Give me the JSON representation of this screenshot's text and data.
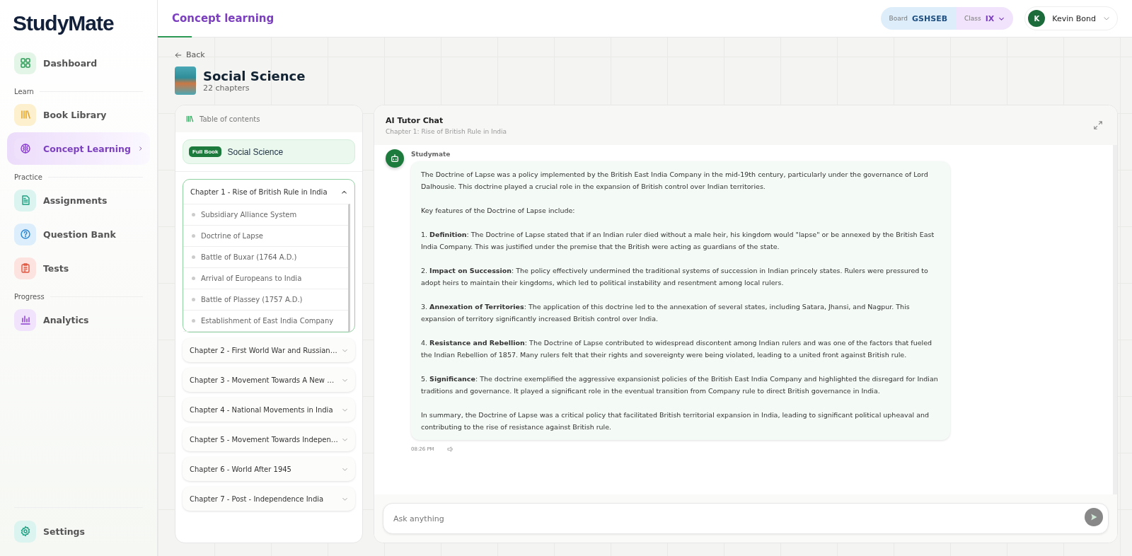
{
  "sidebar": {
    "logo": "StudyMate",
    "groups": [
      {
        "items": [
          {
            "label": "Dashboard",
            "selected": false
          }
        ]
      },
      {
        "heading": "Learn",
        "items": [
          {
            "label": "Book Library",
            "selected": false
          },
          {
            "label": "Concept Learning",
            "selected": true
          }
        ]
      },
      {
        "heading": "Practice",
        "items": [
          {
            "label": "Assignments",
            "selected": false
          },
          {
            "label": "Question Bank",
            "selected": false
          },
          {
            "label": "Tests",
            "selected": false
          }
        ]
      },
      {
        "heading": "Progress",
        "items": [
          {
            "label": "Analytics",
            "selected": false
          }
        ]
      }
    ],
    "footer": {
      "label": "Settings",
      "selected": false
    }
  },
  "header": {
    "title": "Concept learning",
    "board_label": "Board",
    "board": "GSHSEB",
    "class_label": "Class",
    "class": "IX",
    "user": {
      "initial": "K",
      "name": "Kevin Bond"
    }
  },
  "back": "Back",
  "book": {
    "title": "Social Science",
    "chapters": "22 chapters"
  },
  "toc": {
    "title": "Table of contents",
    "full_book": {
      "badge": "Full Book",
      "title": "Social Science"
    },
    "chapters": [
      {
        "title": "Chapter 1 - Rise of British Rule in India",
        "expanded": true,
        "topics": [
          "Subsidiary Alliance System",
          "Doctrine of Lapse",
          "Battle of Buxar (1764 A.D.)",
          "Arrival of Europeans to India",
          "Battle of Plassey (1757 A.D.)",
          "Establishment of East India Company"
        ]
      },
      {
        "title": "Chapter 2 - First World War and Russian…",
        "expanded": false
      },
      {
        "title": "Chapter 3 - Movement Towards A New …",
        "expanded": false
      },
      {
        "title": "Chapter 4 - National Movements in India",
        "expanded": false
      },
      {
        "title": "Chapter 5 - Movement Towards Indepen…",
        "expanded": false
      },
      {
        "title": "Chapter 6 - World After 1945",
        "expanded": false
      },
      {
        "title": "Chapter 7 - Post - Independence India",
        "expanded": false
      }
    ]
  },
  "chat": {
    "title": "AI Tutor Chat",
    "subtitle": "Chapter 1: Rise of British Rule in India",
    "messages": [
      {
        "sender": "Studymate",
        "time": "08:26 PM",
        "paragraphs": [
          "The Doctrine of Lapse was a policy implemented by the British East India Company in the mid-19th century, particularly under the governance of Lord Dalhousie. This doctrine played a crucial role in the expansion of British control over Indian territories.",
          "Key features of the Doctrine of Lapse include:",
          "1. **Definition**: The Doctrine of Lapse stated that if an Indian ruler died without a male heir, his kingdom would \"lapse\" or be annexed by the British East India Company. This was justified under the premise that the British were acting as guardians of the state.",
          "2. **Impact on Succession**: The policy effectively undermined the traditional systems of succession in Indian princely states. Rulers were pressured to adopt heirs to maintain their kingdoms, which led to political instability and resentment among local rulers.",
          "3. **Annexation of Territories**: The application of this doctrine led to the annexation of several states, including Satara, Jhansi, and Nagpur. This expansion of territory significantly increased British control over India.",
          "4. **Resistance and Rebellion**: The Doctrine of Lapse contributed to widespread discontent among Indian rulers and was one of the factors that fueled the Indian Rebellion of 1857. Many rulers felt that their rights and sovereignty were being violated, leading to a united front against British rule.",
          "5. **Significance**: The doctrine exemplified the aggressive expansionist policies of the British East India Company and highlighted the disregard for Indian traditions and governance. It played a significant role in the eventual transition from Company rule to direct British governance in India.",
          "In summary, the Doctrine of Lapse was a critical policy that facilitated British territorial expansion in India, leading to significant political upheaval and contributing to the rise of resistance against British rule."
        ]
      }
    ],
    "input": {
      "placeholder": "Ask anything"
    }
  }
}
